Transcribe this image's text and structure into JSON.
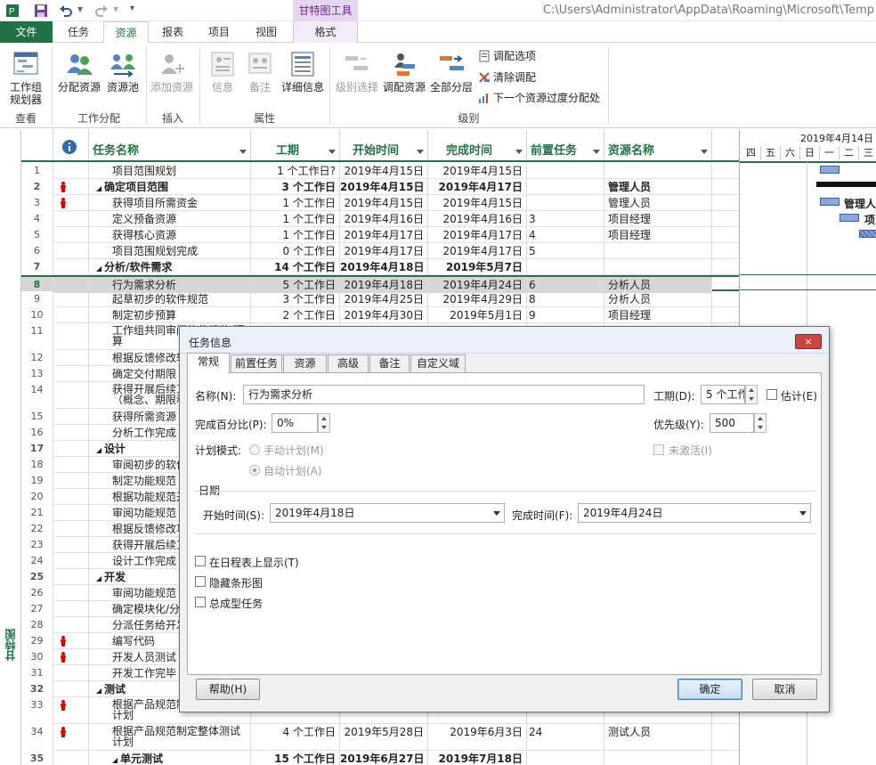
{
  "window": {
    "path": "C:\\Users\\Administrator\\AppData\\Roaming\\Microsoft\\Temp",
    "context_tab_group": "甘特图工具"
  },
  "tabs": [
    "文件",
    "任务",
    "资源",
    "报表",
    "项目",
    "视图",
    "格式"
  ],
  "ribbon": {
    "buttons": {
      "team_planner": "工作组\n规划器",
      "assign_resources": "分配资源",
      "resource_pool": "资源池",
      "add_resource": "添加资源",
      "info": "信息",
      "notes": "备注",
      "details": "详细信息",
      "level_selection": "级别选择",
      "level_resource": "调配资源",
      "level_all": "全部分层",
      "leveling_options": "调配选项",
      "clear_leveling": "清除调配",
      "next_overallocation": "下一个资源过度分配处"
    },
    "groups": {
      "view": "查看",
      "assignments": "工作分配",
      "insert": "插入",
      "properties": "属性",
      "level": "级别"
    }
  },
  "side_label": "甘特图",
  "grid": {
    "headers": [
      "任务名称",
      "工期",
      "开始时间",
      "完成时间",
      "前置任务",
      "资源名称"
    ],
    "rows": [
      {
        "id": "1",
        "name": "项目范围规划",
        "indent": 2,
        "dur": "1 个工作日?",
        "start": "2019年4月15日",
        "finish": "2019年4月15日",
        "pred": "",
        "res": ""
      },
      {
        "id": "2",
        "name": "确定项目范围",
        "indent": 1,
        "summary": true,
        "person": true,
        "dur": "3 个工作日",
        "start": "2019年4月15日",
        "finish": "2019年4月17日",
        "pred": "",
        "res": "管理人员"
      },
      {
        "id": "3",
        "name": "获得项目所需资金",
        "indent": 2,
        "person": true,
        "dur": "1 个工作日",
        "start": "2019年4月15日",
        "finish": "2019年4月15日",
        "pred": "",
        "res": "管理人员"
      },
      {
        "id": "4",
        "name": "定义预备资源",
        "indent": 2,
        "dur": "1 个工作日",
        "start": "2019年4月16日",
        "finish": "2019年4月16日",
        "pred": "3",
        "res": "项目经理"
      },
      {
        "id": "5",
        "name": "获得核心资源",
        "indent": 2,
        "dur": "1 个工作日",
        "start": "2019年4月17日",
        "finish": "2019年4月17日",
        "pred": "4",
        "res": "项目经理"
      },
      {
        "id": "6",
        "name": "项目范围规划完成",
        "indent": 2,
        "dur": "0 个工作日",
        "start": "2019年4月17日",
        "finish": "2019年4月17日",
        "pred": "5",
        "res": ""
      },
      {
        "id": "7",
        "name": "分析/软件需求",
        "indent": 1,
        "summary": true,
        "dur": "14 个工作日",
        "start": "2019年4月18日",
        "finish": "2019年5月7日",
        "pred": "",
        "res": ""
      },
      {
        "id": "8",
        "name": "行为需求分析",
        "indent": 2,
        "selected": true,
        "dur": "5 个工作日",
        "start": "2019年4月18日",
        "finish": "2019年4月24日",
        "pred": "6",
        "res": "分析人员"
      },
      {
        "id": "9",
        "name": "起草初步的软件规范",
        "indent": 2,
        "dur": "3 个工作日",
        "start": "2019年4月25日",
        "finish": "2019年4月29日",
        "pred": "8",
        "res": "分析人员"
      },
      {
        "id": "10",
        "name": "制定初步预算",
        "indent": 2,
        "dur": "2 个工作日",
        "start": "2019年4月30日",
        "finish": "2019年5月1日",
        "pred": "9",
        "res": "项目经理"
      },
      {
        "id": "11",
        "name": "工作组共同审阅软件规范/预算",
        "indent": 2,
        "tall": true,
        "dur": "",
        "start": "",
        "finish": "",
        "pred": "",
        "res": ""
      },
      {
        "id": "12",
        "name": "根据反馈修改软件规范",
        "indent": 2,
        "dur": "",
        "start": "",
        "finish": "",
        "pred": "",
        "res": ""
      },
      {
        "id": "13",
        "name": "确定交付期限",
        "indent": 2,
        "dur": "",
        "start": "",
        "finish": "",
        "pred": "",
        "res": ""
      },
      {
        "id": "14",
        "name": "获得开展后续工作的批准（概念、期限和预算）",
        "indent": 2,
        "tall": true,
        "dur": "",
        "start": "",
        "finish": "",
        "pred": "",
        "res": ""
      },
      {
        "id": "15",
        "name": "获得所需资源",
        "indent": 2,
        "dur": "",
        "start": "",
        "finish": "",
        "pred": "",
        "res": ""
      },
      {
        "id": "16",
        "name": "分析工作完成",
        "indent": 2,
        "dur": "",
        "start": "",
        "finish": "",
        "pred": "",
        "res": ""
      },
      {
        "id": "17",
        "name": "设计",
        "indent": 1,
        "summary": true,
        "dur": "",
        "start": "",
        "finish": "",
        "pred": "",
        "res": ""
      },
      {
        "id": "18",
        "name": "审阅初步的软件规范",
        "indent": 2,
        "dur": "",
        "start": "",
        "finish": "",
        "pred": "",
        "res": ""
      },
      {
        "id": "19",
        "name": "制定功能规范",
        "indent": 2,
        "dur": "",
        "start": "",
        "finish": "",
        "pred": "",
        "res": ""
      },
      {
        "id": "20",
        "name": "根据功能规范开发原型",
        "indent": 2,
        "dur": "",
        "start": "",
        "finish": "",
        "pred": "",
        "res": ""
      },
      {
        "id": "21",
        "name": "审阅功能规范",
        "indent": 2,
        "dur": "",
        "start": "",
        "finish": "",
        "pred": "",
        "res": ""
      },
      {
        "id": "22",
        "name": "根据反馈修改功能规范",
        "indent": 2,
        "dur": "",
        "start": "",
        "finish": "",
        "pred": "",
        "res": ""
      },
      {
        "id": "23",
        "name": "获得开展后续工作的批准",
        "indent": 2,
        "dur": "",
        "start": "",
        "finish": "",
        "pred": "",
        "res": ""
      },
      {
        "id": "24",
        "name": "设计工作完成",
        "indent": 2,
        "dur": "",
        "start": "",
        "finish": "",
        "pred": "",
        "res": ""
      },
      {
        "id": "25",
        "name": "开发",
        "indent": 1,
        "summary": true,
        "dur": "",
        "start": "",
        "finish": "",
        "pred": "",
        "res": ""
      },
      {
        "id": "26",
        "name": "审阅功能规范",
        "indent": 2,
        "dur": "",
        "start": "",
        "finish": "",
        "pred": "",
        "res": ""
      },
      {
        "id": "27",
        "name": "确定模块化/分层设计参数",
        "indent": 2,
        "dur": "",
        "start": "",
        "finish": "",
        "pred": "",
        "res": ""
      },
      {
        "id": "28",
        "name": "分派任务给开发人员",
        "indent": 2,
        "dur": "",
        "start": "",
        "finish": "",
        "pred": "",
        "res": ""
      },
      {
        "id": "29",
        "name": "编写代码",
        "indent": 2,
        "person": true,
        "dur": "",
        "start": "",
        "finish": "",
        "pred": "",
        "res": ""
      },
      {
        "id": "30",
        "name": "开发人员测试（初步调试）",
        "indent": 2,
        "person": true,
        "dur": "",
        "start": "",
        "finish": "",
        "pred": "",
        "res": ""
      },
      {
        "id": "31",
        "name": "开发工作完毕",
        "indent": 2,
        "dur": "",
        "start": "",
        "finish": "",
        "pred": "",
        "res": ""
      },
      {
        "id": "32",
        "name": "测试",
        "indent": 1,
        "summary": true,
        "dur": "",
        "start": "",
        "finish": "",
        "pred": "",
        "res": ""
      },
      {
        "id": "33",
        "name": "根据产品规范制定单元测试计划",
        "indent": 2,
        "tall": true,
        "person": true,
        "dur": "",
        "start": "",
        "finish": "",
        "pred": "",
        "res": ""
      },
      {
        "id": "34",
        "name": "根据产品规范制定整体测试计划",
        "indent": 2,
        "tall": true,
        "person": true,
        "dur": "4 个工作日",
        "start": "2019年5月28日",
        "finish": "2019年6月3日",
        "pred": "24",
        "res": "测试人员"
      },
      {
        "id": "35",
        "name": "单元测试",
        "indent": 2,
        "summary": true,
        "dur": "15 个工作日",
        "start": "2019年6月27日",
        "finish": "2019年7月18日",
        "pred": "",
        "res": ""
      }
    ]
  },
  "gantt": {
    "week_label": "2019年4月14日",
    "days": [
      "四",
      "五",
      "六",
      "日",
      "一",
      "二",
      "三"
    ],
    "bar_labels": [
      "管理人",
      "项"
    ]
  },
  "dialog": {
    "title": "任务信息",
    "close": "×",
    "tabs": [
      "常规",
      "前置任务",
      "资源",
      "高级",
      "备注",
      "自定义域"
    ],
    "name_label": "名称(N):",
    "name_value": "行为需求分析",
    "duration_label": "工期(D):",
    "duration_value": "5 个工作日",
    "estimated_label": "估计(E)",
    "percent_label": "完成百分比(P):",
    "percent_value": "0%",
    "priority_label": "优先级(Y):",
    "priority_value": "500",
    "mode_label": "计划模式:",
    "manual_label": "手动计划(M)",
    "auto_label": "自动计划(A)",
    "inactive_label": "未激活(I)",
    "dates_section": "日期",
    "start_label": "开始时间(S):",
    "start_value": "2019年4月18日",
    "finish_label": "完成时间(F):",
    "finish_value": "2019年4月24日",
    "timeline_label": "在日程表上显示(T)",
    "hide_bar_label": "隐藏条形图",
    "rollup_label": "总成型任务",
    "help_button": "帮助(H)",
    "ok_button": "确定",
    "cancel_button": "取消"
  },
  "colors": {
    "accent": "#217346",
    "context": "#6a2a8a",
    "bar": "#8ea6d8"
  }
}
